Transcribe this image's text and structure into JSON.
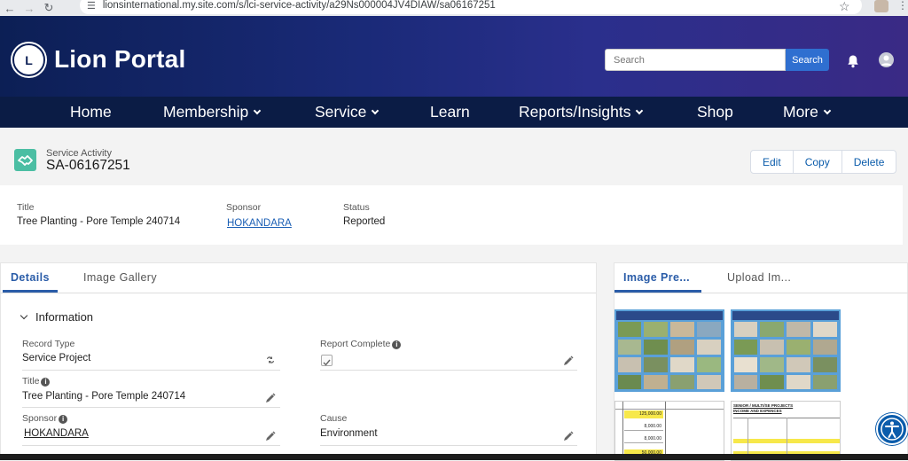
{
  "browser": {
    "url": "lionsinternational.my.site.com/s/lci-service-activity/a29Ns000004JV4DIAW/sa06167251"
  },
  "header": {
    "brand": "Lion Portal",
    "search_placeholder": "Search",
    "search_button": "Search",
    "brand_color": "#0c1f55",
    "accent_color": "#2f6fd0"
  },
  "nav": {
    "items": [
      {
        "label": "Home",
        "dropdown": false
      },
      {
        "label": "Membership",
        "dropdown": true
      },
      {
        "label": "Service",
        "dropdown": true
      },
      {
        "label": "Learn",
        "dropdown": false
      },
      {
        "label": "Reports/Insights",
        "dropdown": true
      },
      {
        "label": "Shop",
        "dropdown": false
      },
      {
        "label": "More",
        "dropdown": true
      }
    ]
  },
  "record": {
    "type": "Service Activity",
    "name": "SA-06167251",
    "icon": "handshake-icon",
    "actions": [
      "Edit",
      "Copy",
      "Delete"
    ]
  },
  "highlights": {
    "title_label": "Title",
    "title_value": "Tree Planting - Pore Temple 240714",
    "sponsor_label": "Sponsor",
    "sponsor_value": "HOKANDARA",
    "status_label": "Status",
    "status_value": "Reported"
  },
  "details": {
    "tabs": [
      "Details",
      "Image Gallery"
    ],
    "section": "Information",
    "fields": {
      "record_type_label": "Record Type",
      "record_type_value": "Service Project",
      "report_complete_label": "Report Complete",
      "report_complete_value": true,
      "title_label": "Title",
      "title_value": "Tree Planting - Pore Temple 240714",
      "sponsor_label": "Sponsor",
      "sponsor_value": "HOKANDARA",
      "cause_label": "Cause",
      "cause_value": "Environment"
    }
  },
  "images": {
    "tabs": [
      "Image Pre...",
      "Upload Im..."
    ],
    "amounts": [
      "125,000.00",
      "8,000.00",
      "8,000.00",
      "50,000.00"
    ],
    "doc_heading_1": "SENIOR / MULTI/SE PROJECTS",
    "doc_heading_2": "INCOME AND EXPENCES"
  }
}
